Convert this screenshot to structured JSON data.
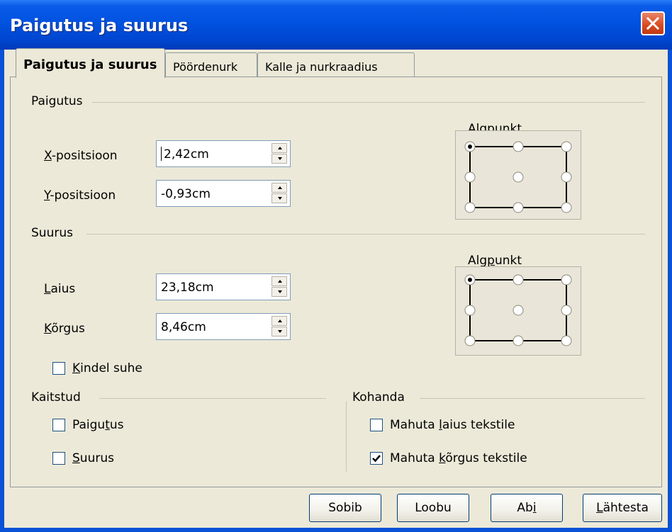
{
  "window": {
    "title": "Paigutus ja suurus"
  },
  "tabs": [
    {
      "label": "Paigutus ja suurus",
      "active": true
    },
    {
      "label": "Pöördenurk",
      "active": false
    },
    {
      "label": "Kalle ja nurkraadius",
      "active": false
    }
  ],
  "position": {
    "section_label": "Paigutus",
    "x_label_pre": "",
    "x_label_u": "X",
    "x_label_post": "-positsioon",
    "x_value": "2,42cm",
    "y_label_u": "Y",
    "y_label_post": "-positsioon",
    "y_value": "-0,93cm",
    "base_point_pre": "Al",
    "base_point_u": "g",
    "base_point_post": "punkt",
    "base_point_selected": "top-left"
  },
  "size": {
    "section_label": "Suurus",
    "width_label_u": "L",
    "width_label_post": "aius",
    "width_value": "23,18cm",
    "height_label_u": "K",
    "height_label_post": "õrgus",
    "height_value": "8,46cm",
    "keep_ratio_u": "K",
    "keep_ratio_post": "indel suhe",
    "keep_ratio_checked": false,
    "base_point_pre": "Alg",
    "base_point_u": "p",
    "base_point_post": "unkt",
    "base_point_selected": "top-left"
  },
  "protect": {
    "section_label": "Kaitstud",
    "position_pre": "Paigu",
    "position_u": "t",
    "position_post": "us",
    "position_checked": false,
    "size_u": "S",
    "size_post": "uurus",
    "size_checked": false
  },
  "adapt": {
    "section_label": "Kohanda",
    "fit_width_pre": "Mahuta ",
    "fit_width_u": "l",
    "fit_width_post": "aius tekstile",
    "fit_width_checked": false,
    "fit_height_pre": "Mahuta ",
    "fit_height_u": "k",
    "fit_height_post": "õrgus tekstile",
    "fit_height_checked": true
  },
  "buttons": {
    "ok": "Sobib",
    "cancel": "Loobu",
    "help_pre": "Ab",
    "help_u": "i",
    "help_post": "",
    "reset_u": "L",
    "reset_post": "ähtesta"
  },
  "colors": {
    "titlebar": "#0052e0",
    "face": "#ece9d8",
    "close": "#d8491f"
  }
}
